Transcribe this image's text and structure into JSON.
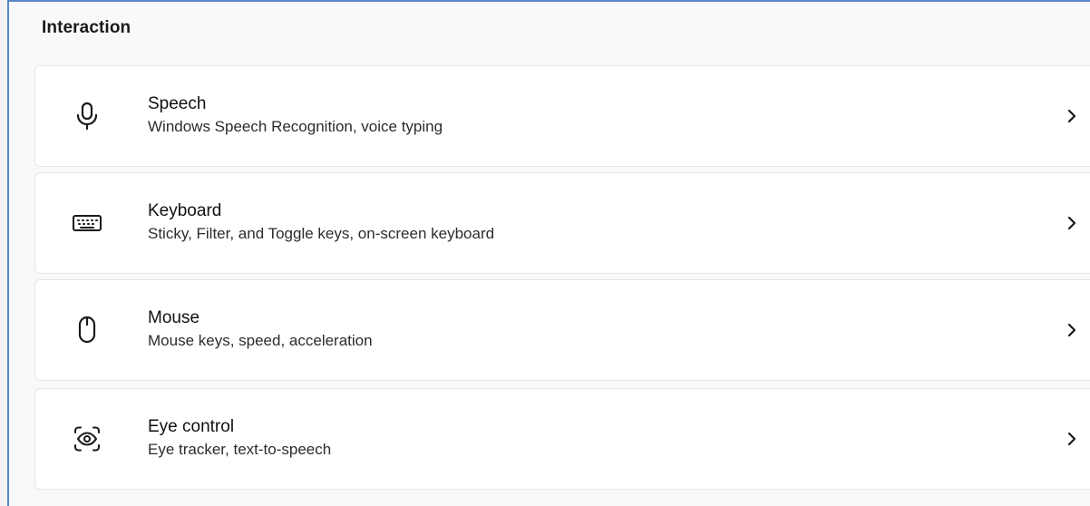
{
  "section": {
    "title": "Interaction"
  },
  "items": [
    {
      "title": "Speech",
      "subtitle": "Windows Speech Recognition, voice typing",
      "icon": "microphone-icon"
    },
    {
      "title": "Keyboard",
      "subtitle": "Sticky, Filter, and Toggle keys, on-screen keyboard",
      "icon": "keyboard-icon"
    },
    {
      "title": "Mouse",
      "subtitle": "Mouse keys, speed, acceleration",
      "icon": "mouse-icon"
    },
    {
      "title": "Eye control",
      "subtitle": "Eye tracker, text-to-speech",
      "icon": "eye-control-icon"
    }
  ],
  "colors": {
    "accent_border": "#5a88c9",
    "card_bg": "#ffffff",
    "page_bg": "#f8f9fb"
  }
}
